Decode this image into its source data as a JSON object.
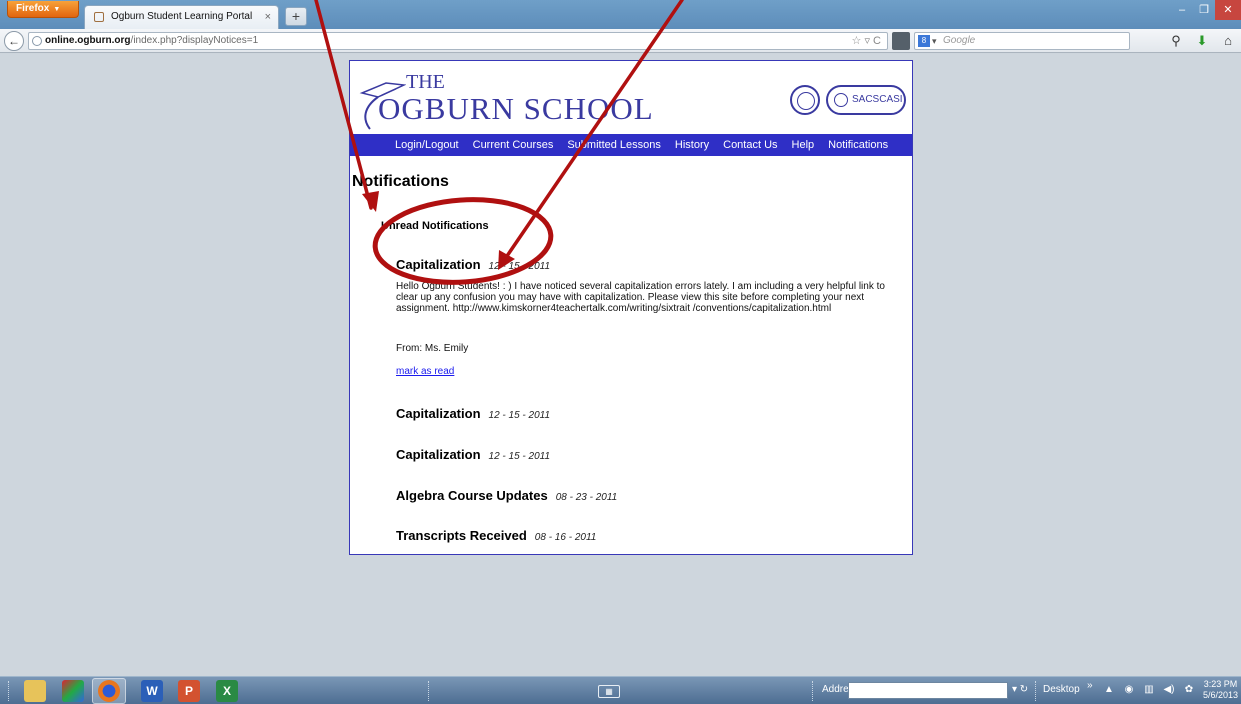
{
  "browser": {
    "menu_label": "Firefox",
    "tab_title": "Ogburn Student Learning Portal",
    "url_domain": "online.ogburn.org",
    "url_path": "/index.php?displayNotices=1",
    "search_placeholder": "Google"
  },
  "site": {
    "logo_the": "THE",
    "logo_school": "OGBURN SCHOOL",
    "accreditation": "SACSCASI",
    "nav": [
      "Login/Logout",
      "Current Courses",
      "Submitted Lessons",
      "History",
      "Contact Us",
      "Help",
      "Notifications"
    ]
  },
  "page": {
    "title": "Notifications",
    "unread_heading": "Unread Notifications",
    "notifications": [
      {
        "title": "Capitalization",
        "date": "12 - 15 - 2011",
        "body": "Hello Ogburn Students! : ) I have noticed several capitalization errors lately. I am including a very helpful link to clear up any confusion you may have with capitalization. Please view this site before completing your next assignment. http://www.kimskorner4teachertalk.com/writing/sixtrait /conventions/capitalization.html",
        "from": "From: Ms. Emily",
        "action": "mark as read"
      },
      {
        "title": "Capitalization",
        "date": "12 - 15 - 2011"
      },
      {
        "title": "Capitalization",
        "date": "12 - 15 - 2011"
      },
      {
        "title": "Algebra Course Updates",
        "date": "08 - 23 - 2011"
      },
      {
        "title": "Transcripts Received",
        "date": "08 - 16 - 2011"
      }
    ]
  },
  "annotation_color": "#b01010",
  "taskbar": {
    "address_label": "Address",
    "desktop_label": "Desktop",
    "time": "3:23 PM",
    "date": "5/6/2013"
  }
}
